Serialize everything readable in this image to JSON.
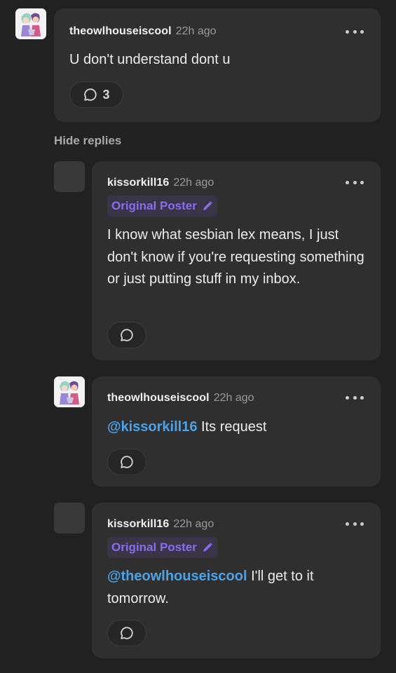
{
  "comments": [
    {
      "username": "theowlhouseiscool",
      "time": "22h ago",
      "text": "U don't understand dont u",
      "reply_count": "3",
      "avatar": "cartoon-avatar"
    }
  ],
  "hide_replies_label": "Hide replies",
  "replies": [
    {
      "username": "kissorkill16",
      "time": "22h ago",
      "badge": "Original Poster",
      "text": "I know what sesbian lex means, I just don't know if you're requesting something or just putting stuff in my inbox."
    },
    {
      "username": "theowlhouseiscool",
      "time": "22h ago",
      "mention": "@kissorkill16",
      "text": " Its request",
      "avatar": "cartoon-avatar"
    },
    {
      "username": "kissorkill16",
      "time": "22h ago",
      "badge": "Original Poster",
      "mention": "@theowlhouseiscool",
      "text": " I'll get to it tomorrow."
    }
  ],
  "icons": {
    "more": "more-dots-icon",
    "reply": "speech-bubble-icon",
    "edit": "pencil-icon"
  },
  "colors": {
    "background": "#212121",
    "card": "#2f2f2f",
    "op_badge_text": "#8a6cf0",
    "op_badge_bg": "#3a3447",
    "mention": "#4aa3e8"
  }
}
